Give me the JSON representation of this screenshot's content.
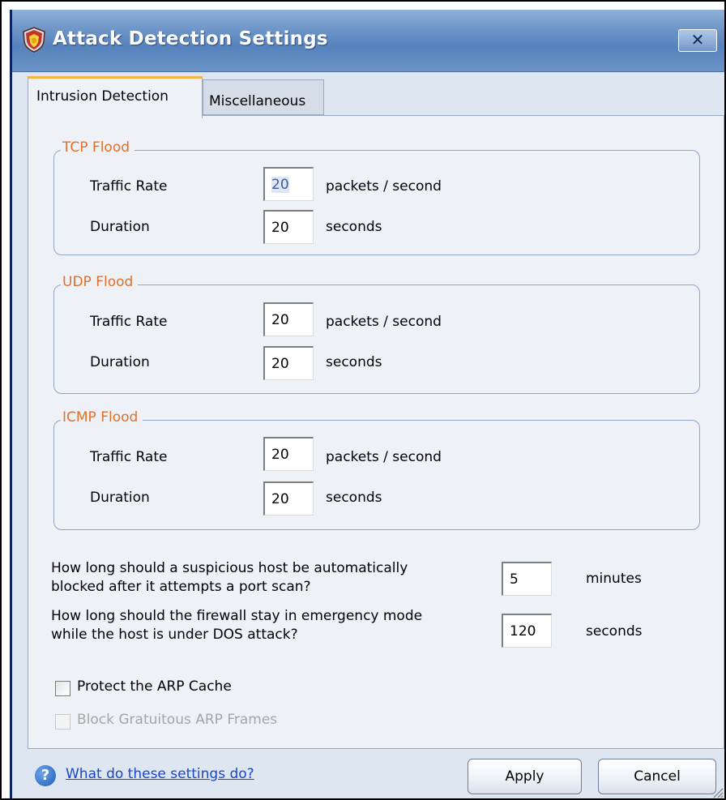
{
  "window": {
    "title": "Attack Detection Settings",
    "close_label": "✕",
    "icon": "shield-icon"
  },
  "tabs": [
    {
      "label": "Intrusion Detection",
      "active": true
    },
    {
      "label": "Miscellaneous",
      "active": false
    }
  ],
  "groups": {
    "tcp": {
      "title": "TCP Flood",
      "rate_label": "Traffic Rate",
      "rate_value": "20",
      "rate_unit": "packets / second",
      "duration_label": "Duration",
      "duration_value": "20",
      "duration_unit": "seconds"
    },
    "udp": {
      "title": "UDP Flood",
      "rate_label": "Traffic Rate",
      "rate_value": "20",
      "rate_unit": "packets / second",
      "duration_label": "Duration",
      "duration_value": "20",
      "duration_unit": "seconds"
    },
    "icmp": {
      "title": "ICMP Flood",
      "rate_label": "Traffic Rate",
      "rate_value": "20",
      "rate_unit": "packets / second",
      "duration_label": "Duration",
      "duration_value": "20",
      "duration_unit": "seconds"
    }
  },
  "questions": {
    "portscan": {
      "line1": "How long should a suspicious host be automatically",
      "line2": "blocked after it attempts a port scan?",
      "value": "5",
      "unit": "minutes"
    },
    "emergency": {
      "line1": "How long should the firewall stay in emergency mode",
      "line2": "while the host is under DOS attack?",
      "value": "120",
      "unit": "seconds"
    }
  },
  "options": {
    "protect_arp": {
      "label": "Protect the ARP Cache",
      "checked": false,
      "enabled": true
    },
    "block_arp": {
      "label": "Block Gratuitous ARP Frames",
      "checked": false,
      "enabled": false
    }
  },
  "footer": {
    "help_text": "What do these settings do?",
    "apply_label": "Apply",
    "cancel_label": "Cancel"
  },
  "colors": {
    "titlebar": "#5682bd",
    "legend": "#e0702a",
    "link": "#1a46c8",
    "tab_highlight": "#f2b544"
  }
}
